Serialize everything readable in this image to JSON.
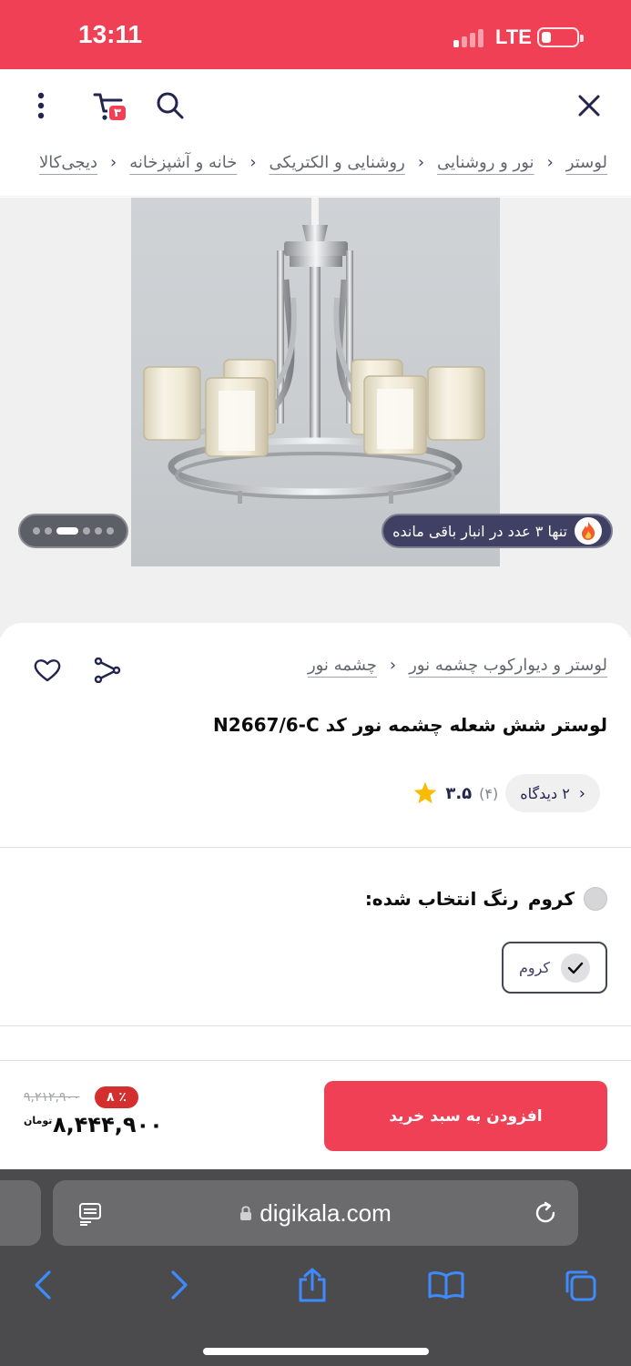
{
  "status_bar": {
    "time": "13:11",
    "network": "LTE"
  },
  "cart": {
    "count": "۳"
  },
  "breadcrumb": [
    {
      "label": "دیجی‌کالا"
    },
    {
      "label": "خانه و آشپزخانه"
    },
    {
      "label": "روشنایی و الکتریکی"
    },
    {
      "label": "نور و روشنایی"
    },
    {
      "label": "لوستر"
    }
  ],
  "gallery": {
    "stock_notice": "تنها ۳ عدد در انبار باقی مانده",
    "image_count": 6,
    "active_index": 2
  },
  "product": {
    "brand": "چشمه نور",
    "collection": "لوستر و دیوارکوب چشمه نور",
    "title": "لوستر شش شعله چشمه نور کد N2667/6-C",
    "rating": "۳.۵",
    "rating_count": "(۴)",
    "reviews_label": "۲ دیدگاه"
  },
  "color": {
    "selected_label": "رنگ انتخاب شده:",
    "selected_value": "کروم",
    "options": [
      {
        "label": "کروم",
        "selected": true
      }
    ]
  },
  "purchase": {
    "add_to_cart": "افزودن به سبد خرید",
    "old_price": "۹,۲۱۲,۹۰۰",
    "discount": "۸ ٪",
    "price": "۸,۴۴۴,۹۰۰",
    "currency": "تومان"
  },
  "browser": {
    "url": "digikala.com"
  },
  "colors": {
    "brand": "#ef4056",
    "dark": "#23254e",
    "safari_bg": "#4b4b4d"
  }
}
